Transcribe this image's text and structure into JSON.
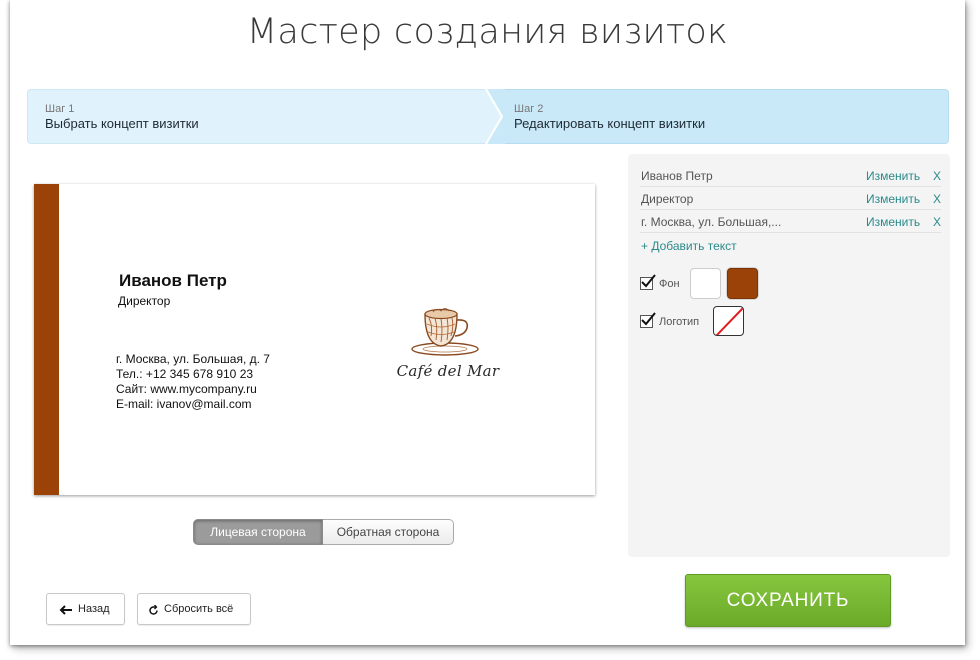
{
  "page": {
    "title": "Мастер создания визиток"
  },
  "steps": [
    {
      "num": "Шаг 1",
      "label": "Выбрать концепт визитки"
    },
    {
      "num": "Шаг 2",
      "label": "Редактировать концепт визитки"
    }
  ],
  "card": {
    "name": "Иванов Петр",
    "position": "Директор",
    "address": "г. Москва, ул. Большая, д. 7",
    "phone": "Тел.: +12 345 678 910 23",
    "site": "Сайт: www.mycompany.ru",
    "email": "E-mail: ivanov@mail.com",
    "logo_text": "Café del Mar",
    "stripe_color": "#9a4207"
  },
  "sides": {
    "front": "Лицевая сторона",
    "back": "Обратная сторона",
    "active": "front"
  },
  "panel": {
    "fields": [
      {
        "text": "Иванов Петр",
        "edit": "Изменить",
        "remove": "X"
      },
      {
        "text": "Директор",
        "edit": "Изменить",
        "remove": "X"
      },
      {
        "text": "г. Москва, ул. Большая,...",
        "edit": "Изменить",
        "remove": "X"
      }
    ],
    "add_text": "+ Добавить текст",
    "background": {
      "label": "Фон",
      "checked": true,
      "colors": [
        "#ffffff",
        "#9a4207"
      ]
    },
    "logo": {
      "label": "Логотип",
      "checked": true
    }
  },
  "buttons": {
    "back": "Назад",
    "reset": "Сбросить всё",
    "save": "СОХРАНИТЬ"
  },
  "colors": {
    "accent_green": "#7ab833",
    "link_teal": "#2a8a8a",
    "step_blue": "#c9e9f8"
  }
}
